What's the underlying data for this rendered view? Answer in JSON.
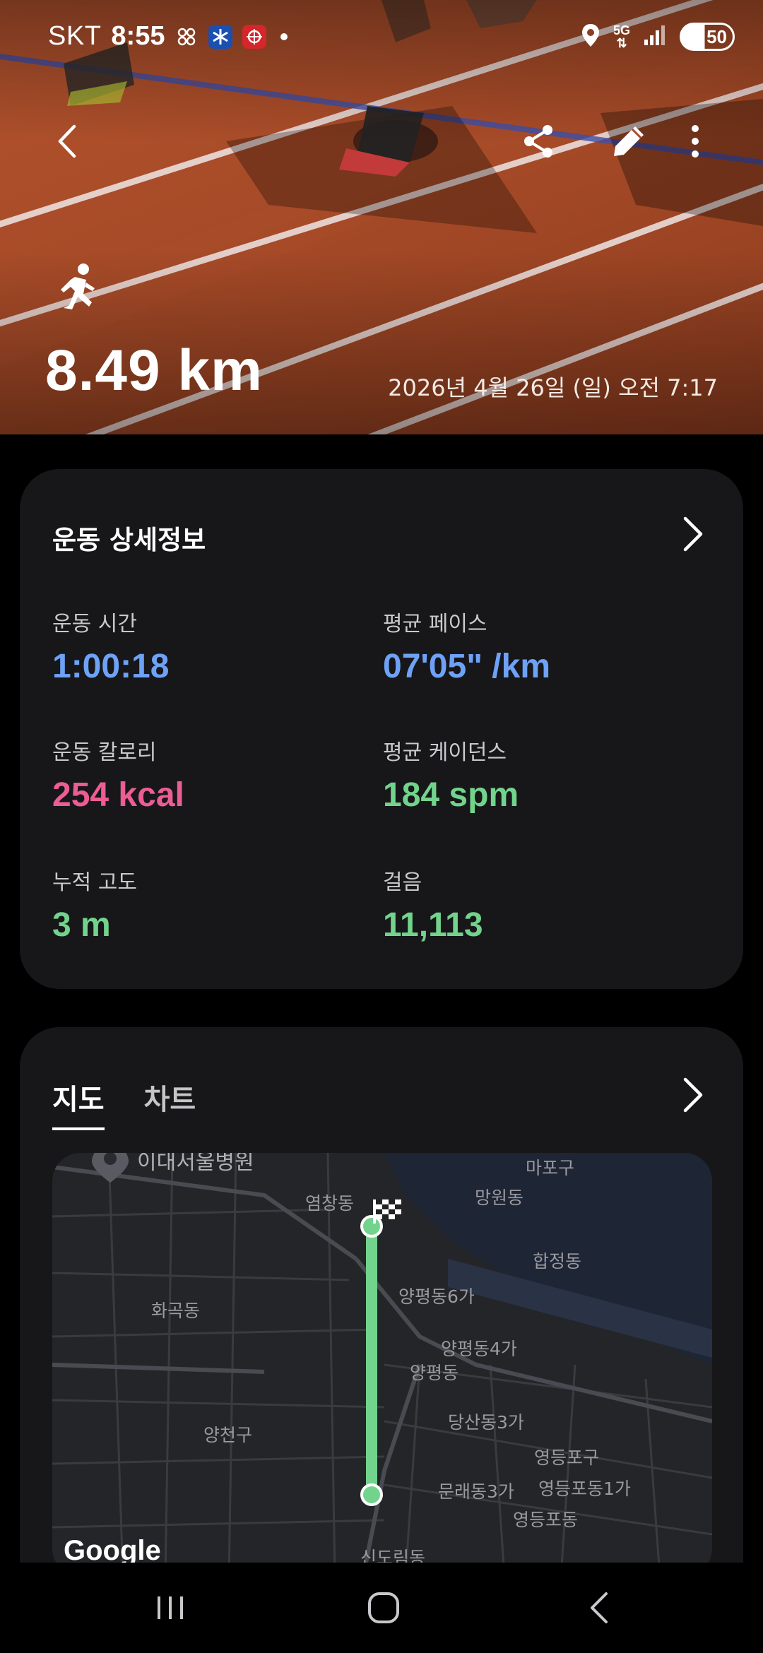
{
  "status": {
    "carrier": "SKT",
    "time": "8:55",
    "battery": "50",
    "network": "5G"
  },
  "hero": {
    "distance": "8.49 km",
    "datetime": "2026년 4월 26일 (일) 오전 7:17",
    "activity_icon": "running-icon"
  },
  "details": {
    "title": "운동 상세정보",
    "stats": [
      {
        "label": "운동 시간",
        "value": "1:00:18",
        "color": "#6ea2f7"
      },
      {
        "label": "평균 페이스",
        "value": "07'05\" /km",
        "color": "#6ea2f7"
      },
      {
        "label": "운동 칼로리",
        "value": "254 kcal",
        "color": "#ec5d93"
      },
      {
        "label": "평균 케이던스",
        "value": "184 spm",
        "color": "#72d38c"
      },
      {
        "label": "누적 고도",
        "value": "3 m",
        "color": "#72d38c"
      },
      {
        "label": "걸음",
        "value": "11,113",
        "color": "#72d38c"
      }
    ]
  },
  "map_section": {
    "tabs": [
      "지도",
      "차트"
    ],
    "active_tab": "지도",
    "places": [
      "이대서울병원",
      "마포구",
      "망원동",
      "염창동",
      "합정동",
      "화곡동",
      "양평동6가",
      "양평동4가",
      "양평동",
      "양천구",
      "당산동3가",
      "영등포구",
      "문래동3가",
      "영등포동1가",
      "영등포동",
      "신도림동"
    ],
    "attribution": "Google"
  },
  "colors": {
    "accent_blue": "#6ea2f7",
    "accent_pink": "#ec5d93",
    "accent_green": "#72d38c",
    "card_bg": "#17171a"
  }
}
